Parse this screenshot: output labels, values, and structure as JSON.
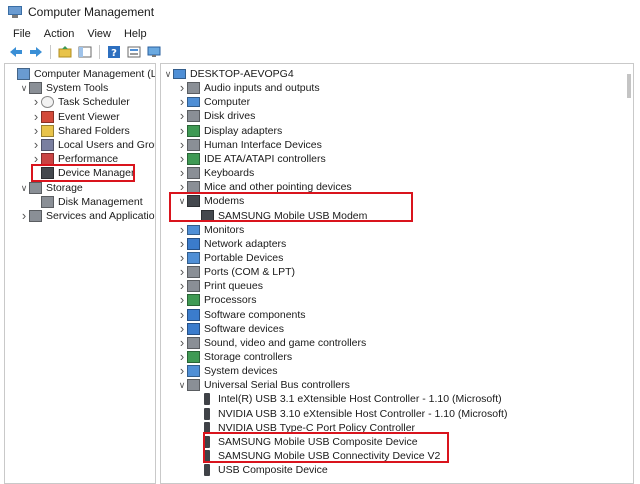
{
  "window": {
    "title": "Computer Management"
  },
  "menu": [
    "File",
    "Action",
    "View",
    "Help"
  ],
  "toolbar": {
    "icons": [
      "back-arrow-icon",
      "forward-arrow-icon",
      "up-folder-icon",
      "show-hide-tree-icon",
      "help-icon",
      "properties-icon",
      "monitor-icon"
    ]
  },
  "left_tree": [
    {
      "label": "Computer Management (Local",
      "depth": 0,
      "chevron": "",
      "icon": "computer-management-icon",
      "color": "#6a9bd1"
    },
    {
      "label": "System Tools",
      "depth": 1,
      "chevron": "v",
      "icon": "system-tools-icon",
      "color": "#8a8f96"
    },
    {
      "label": "Task Scheduler",
      "depth": 2,
      "chevron": ">",
      "icon": "clock-icon",
      "color": "#f2f2f2"
    },
    {
      "label": "Event Viewer",
      "depth": 2,
      "chevron": ">",
      "icon": "event-viewer-icon",
      "color": "#d34a3a"
    },
    {
      "label": "Shared Folders",
      "depth": 2,
      "chevron": ">",
      "icon": "shared-folder-icon",
      "color": "#e8c34a"
    },
    {
      "label": "Local Users and Groups",
      "depth": 2,
      "chevron": ">",
      "icon": "users-icon",
      "color": "#7a7fa0"
    },
    {
      "label": "Performance",
      "depth": 2,
      "chevron": ">",
      "icon": "performance-icon",
      "color": "#c94444"
    },
    {
      "label": "Device Manager",
      "depth": 2,
      "chevron": "",
      "icon": "device-manager-icon",
      "color": "#44484e"
    },
    {
      "label": "Storage",
      "depth": 1,
      "chevron": "v",
      "icon": "storage-icon",
      "color": "#8a8f96"
    },
    {
      "label": "Disk Management",
      "depth": 2,
      "chevron": "",
      "icon": "disk-icon",
      "color": "#8a8f96"
    },
    {
      "label": "Services and Applications",
      "depth": 1,
      "chevron": ">",
      "icon": "services-icon",
      "color": "#8a8f96"
    }
  ],
  "right_tree": [
    {
      "label": "DESKTOP-AEVOPG4",
      "depth": 0,
      "chevron": "v",
      "icon": "computer-icon",
      "color": "#4f8fd6"
    },
    {
      "label": "Audio inputs and outputs",
      "depth": 1,
      "chevron": ">",
      "icon": "audio-icon",
      "color": "#8a8f96"
    },
    {
      "label": "Computer",
      "depth": 1,
      "chevron": ">",
      "icon": "computer-icon",
      "color": "#4f8fd6"
    },
    {
      "label": "Disk drives",
      "depth": 1,
      "chevron": ">",
      "icon": "disk-drive-icon",
      "color": "#8a8f96"
    },
    {
      "label": "Display adapters",
      "depth": 1,
      "chevron": ">",
      "icon": "display-adapter-icon",
      "color": "#3f9a54"
    },
    {
      "label": "Human Interface Devices",
      "depth": 1,
      "chevron": ">",
      "icon": "hid-icon",
      "color": "#8a8f96"
    },
    {
      "label": "IDE ATA/ATAPI controllers",
      "depth": 1,
      "chevron": ">",
      "icon": "ide-controller-icon",
      "color": "#3f9a54"
    },
    {
      "label": "Keyboards",
      "depth": 1,
      "chevron": ">",
      "icon": "keyboard-icon",
      "color": "#8a8f96"
    },
    {
      "label": "Mice and other pointing devices",
      "depth": 1,
      "chevron": ">",
      "icon": "mouse-icon",
      "color": "#8a8f96"
    },
    {
      "label": "Modems",
      "depth": 1,
      "chevron": "v",
      "icon": "modem-icon",
      "color": "#44484e"
    },
    {
      "label": "SAMSUNG Mobile USB Modem",
      "depth": 2,
      "chevron": "",
      "icon": "modem-icon",
      "color": "#44484e"
    },
    {
      "label": "Monitors",
      "depth": 1,
      "chevron": ">",
      "icon": "monitor-icon",
      "color": "#4f8fd6"
    },
    {
      "label": "Network adapters",
      "depth": 1,
      "chevron": ">",
      "icon": "network-adapter-icon",
      "color": "#3b7ccc"
    },
    {
      "label": "Portable Devices",
      "depth": 1,
      "chevron": ">",
      "icon": "portable-device-icon",
      "color": "#4f8fd6"
    },
    {
      "label": "Ports (COM & LPT)",
      "depth": 1,
      "chevron": ">",
      "icon": "port-icon",
      "color": "#8a8f96"
    },
    {
      "label": "Print queues",
      "depth": 1,
      "chevron": ">",
      "icon": "printer-icon",
      "color": "#8a8f96"
    },
    {
      "label": "Processors",
      "depth": 1,
      "chevron": ">",
      "icon": "processor-icon",
      "color": "#3f9a54"
    },
    {
      "label": "Software components",
      "depth": 1,
      "chevron": ">",
      "icon": "software-component-icon",
      "color": "#3b7ccc"
    },
    {
      "label": "Software devices",
      "depth": 1,
      "chevron": ">",
      "icon": "software-device-icon",
      "color": "#3b7ccc"
    },
    {
      "label": "Sound, video and game controllers",
      "depth": 1,
      "chevron": ">",
      "icon": "sound-icon",
      "color": "#8a8f96"
    },
    {
      "label": "Storage controllers",
      "depth": 1,
      "chevron": ">",
      "icon": "storage-controller-icon",
      "color": "#3f9a54"
    },
    {
      "label": "System devices",
      "depth": 1,
      "chevron": ">",
      "icon": "system-device-icon",
      "color": "#4f8fd6"
    },
    {
      "label": "Universal Serial Bus controllers",
      "depth": 1,
      "chevron": "v",
      "icon": "usb-controller-icon",
      "color": "#8a8f96"
    },
    {
      "label": "Intel(R) USB 3.1 eXtensible Host Controller - 1.10 (Microsoft)",
      "depth": 2,
      "chevron": "",
      "icon": "usb-icon",
      "color": "#3f4247"
    },
    {
      "label": "NVIDIA USB 3.10 eXtensible Host Controller - 1.10 (Microsoft)",
      "depth": 2,
      "chevron": "",
      "icon": "usb-icon",
      "color": "#3f4247"
    },
    {
      "label": "NVIDIA USB Type-C Port Policy Controller",
      "depth": 2,
      "chevron": "",
      "icon": "usb-icon",
      "color": "#3f4247"
    },
    {
      "label": "SAMSUNG Mobile USB Composite Device",
      "depth": 2,
      "chevron": "",
      "icon": "usb-icon",
      "color": "#3f4247"
    },
    {
      "label": "SAMSUNG Mobile USB Connectivity Device V2",
      "depth": 2,
      "chevron": "",
      "icon": "usb-icon",
      "color": "#3f4247"
    },
    {
      "label": "USB Composite Device",
      "depth": 2,
      "chevron": "",
      "icon": "usb-icon",
      "color": "#3f4247"
    }
  ],
  "highlight_color": "#d9141d"
}
